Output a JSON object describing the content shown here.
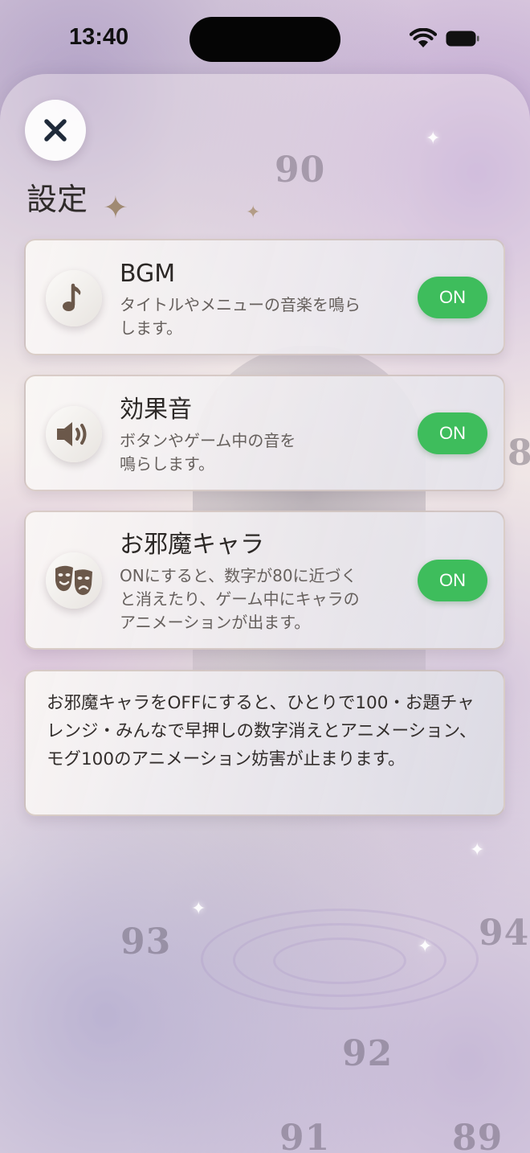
{
  "status_bar": {
    "time": "13:40"
  },
  "header": {
    "close_icon": "close-icon",
    "title": "設定"
  },
  "settings": [
    {
      "id": "bgm",
      "icon": "music-note-icon",
      "title": "BGM",
      "description": "タイトルやメニューの音楽を鳴ら\nします。",
      "toggle": "ON"
    },
    {
      "id": "sound-effects",
      "icon": "speaker-icon",
      "title": "効果音",
      "description": "ボタンやゲーム中の音を\n鳴らします。",
      "toggle": "ON"
    },
    {
      "id": "obstacle-character",
      "icon": "theater-masks-icon",
      "title": "お邪魔キャラ",
      "description": "ONにすると、数字が80に近づく\nと消えたり、ゲーム中にキャラの\nアニメーションが出ます。",
      "toggle": "ON"
    }
  ],
  "notice": {
    "text": "お邪魔キャラをOFFにすると、ひとりで100・お題チャレンジ・みんなで早押しの数字消えとアニメーション、モグ100のアニメーション妨害が止まります。"
  },
  "background": {
    "numbers": [
      "90",
      "93",
      "94",
      "92",
      "91",
      "89",
      "8"
    ]
  },
  "colors": {
    "toggle_on": "#3ebd5c",
    "icon_brown": "#6b584a"
  }
}
